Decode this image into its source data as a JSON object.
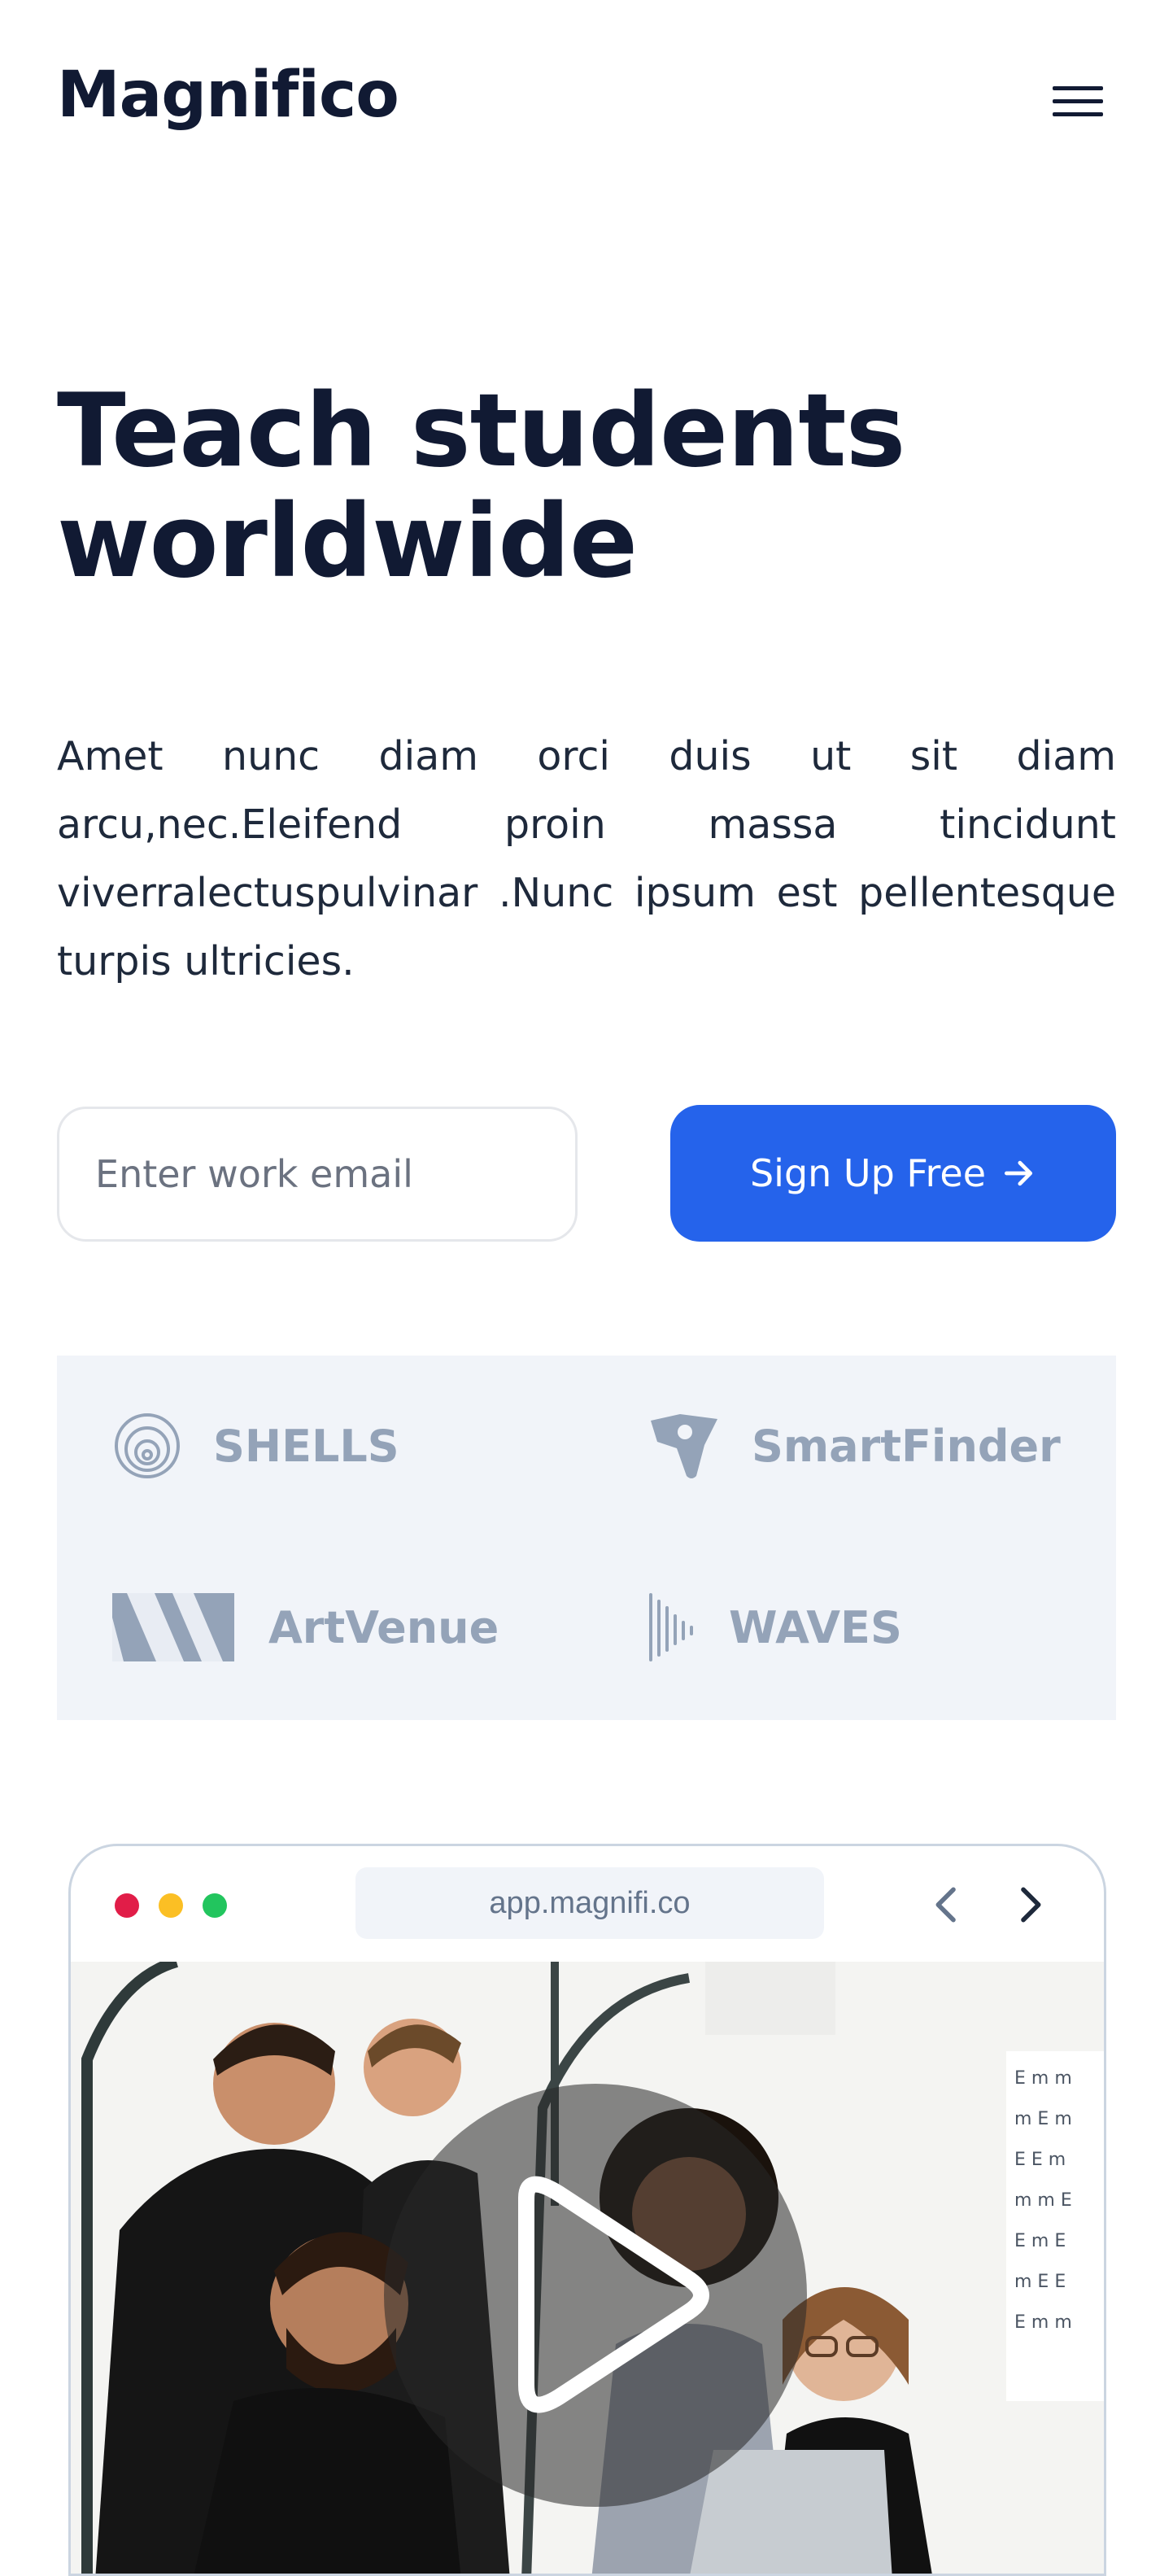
{
  "header": {
    "logo": "Magnifico",
    "menu_icon": "hamburger-menu-icon"
  },
  "hero": {
    "title_line1": "Teach students",
    "title_line2": "worldwide",
    "description": "Amet nunc diam orci duis ut sit diam arcu,nec.Eleifend proin massa tincidunt viverralectuspulvinar .Nunc ipsum est pellentesque turpis ultricies."
  },
  "signup": {
    "email_placeholder": "Enter work email",
    "email_value": "",
    "button_label": "Sign Up Free",
    "button_icon": "arrow-right-icon",
    "accent_color": "#2563eb"
  },
  "partners": [
    {
      "name": "SHELLS",
      "icon": "shells-logo-icon"
    },
    {
      "name": "SmartFinder",
      "icon": "smartfinder-logo-icon"
    },
    {
      "name": "ArtVenue",
      "icon": "artvenue-logo-icon"
    },
    {
      "name": "WAVES",
      "icon": "waves-logo-icon"
    }
  ],
  "browser_preview": {
    "url": "app.magnifi.co",
    "window_dots": [
      "#e11d48",
      "#fbbf24",
      "#22c55e"
    ],
    "nav_icons": [
      "chevron-left-icon",
      "chevron-right-icon"
    ],
    "media": {
      "icon": "play-icon",
      "image": "team-photo"
    }
  }
}
